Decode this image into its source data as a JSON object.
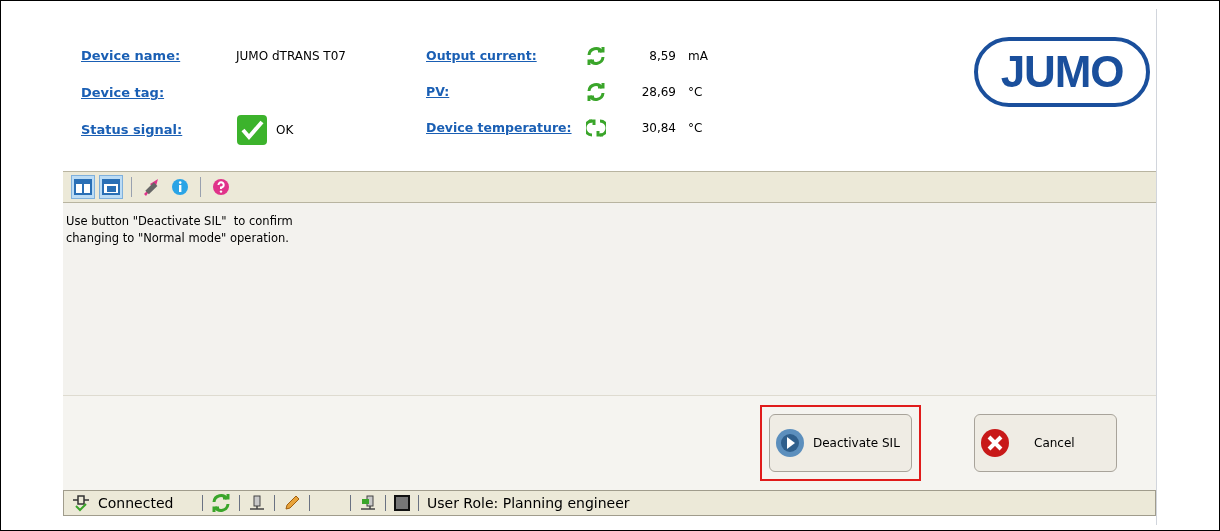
{
  "device_info": {
    "left": [
      {
        "label": "Device name:",
        "value": "JUMO dTRANS T07"
      },
      {
        "label": "Device tag:"
      },
      {
        "label": "Status signal:",
        "status": "OK",
        "ok": true
      }
    ],
    "right": [
      {
        "label": "Output current:",
        "value": "8,59",
        "unit": "mA",
        "kind": "refresh"
      },
      {
        "label": "PV:",
        "value": "28,69",
        "unit": "°C",
        "kind": "refresh"
      },
      {
        "label": "Device temperature:",
        "value": "30,84",
        "unit": "°C",
        "kind": "cycle"
      }
    ],
    "logo": "JUMO"
  },
  "toolbar": [
    {
      "kind": "layout-a",
      "selected": true
    },
    {
      "kind": "layout-b",
      "selected": true
    },
    {
      "kind": "separator"
    },
    {
      "kind": "tool",
      "selected": false
    },
    {
      "kind": "info",
      "selected": false
    },
    {
      "kind": "separator"
    },
    {
      "kind": "help",
      "selected": false
    }
  ],
  "message": [
    "Use button \"Deactivate SIL\"  to confirm",
    "changing to \"Normal mode\" operation."
  ],
  "buttons": [
    {
      "kind": "play",
      "label": "Deactivate SIL",
      "highlighted": true
    },
    {
      "kind": "cancel",
      "label": "Cancel",
      "highlighted": false
    }
  ],
  "status_bar": {
    "connection": "Connected",
    "user_role": "User Role: Planning engineer"
  }
}
